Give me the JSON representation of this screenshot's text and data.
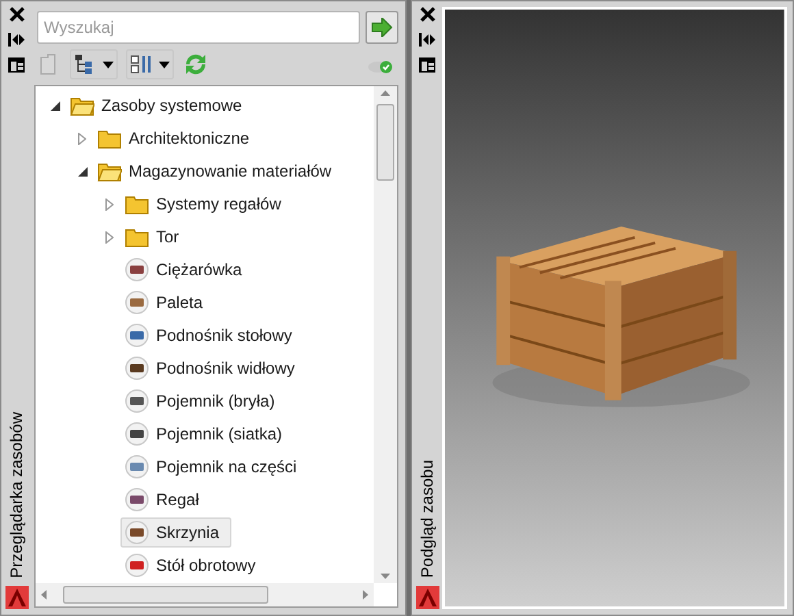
{
  "browser_palette": {
    "title": "Przeglądarka zasobów",
    "search": {
      "placeholder": "Wyszukaj"
    },
    "tree": [
      {
        "kind": "folder",
        "label": "Zasoby systemowe",
        "expanded": true,
        "selected": false,
        "children": [
          {
            "kind": "folder",
            "label": "Architektoniczne",
            "expanded": false,
            "selected": false
          },
          {
            "kind": "folder",
            "label": "Magazynowanie materiałów",
            "expanded": true,
            "selected": false,
            "children": [
              {
                "kind": "folder",
                "label": "Systemy regałów",
                "expanded": false,
                "selected": false
              },
              {
                "kind": "folder",
                "label": "Tor",
                "expanded": false,
                "selected": false
              },
              {
                "kind": "item",
                "label": "Ciężarówka",
                "selected": false,
                "color": "#8a4040"
              },
              {
                "kind": "item",
                "label": "Paleta",
                "selected": false,
                "color": "#9a6a40"
              },
              {
                "kind": "item",
                "label": "Podnośnik stołowy",
                "selected": false,
                "color": "#3a6aa8"
              },
              {
                "kind": "item",
                "label": "Podnośnik widłowy",
                "selected": false,
                "color": "#5a3a20"
              },
              {
                "kind": "item",
                "label": "Pojemnik (bryła)",
                "selected": false,
                "color": "#555555"
              },
              {
                "kind": "item",
                "label": "Pojemnik (siatka)",
                "selected": false,
                "color": "#444444"
              },
              {
                "kind": "item",
                "label": "Pojemnik na części",
                "selected": false,
                "color": "#6a8ab0"
              },
              {
                "kind": "item",
                "label": "Regał",
                "selected": false,
                "color": "#7a4a6a"
              },
              {
                "kind": "item",
                "label": "Skrzynia",
                "selected": true,
                "color": "#7a4a2a"
              },
              {
                "kind": "item",
                "label": "Stół obrotowy",
                "selected": false,
                "color": "#d02020"
              }
            ]
          }
        ]
      }
    ]
  },
  "preview_palette": {
    "title": "Podgląd zasobu"
  }
}
